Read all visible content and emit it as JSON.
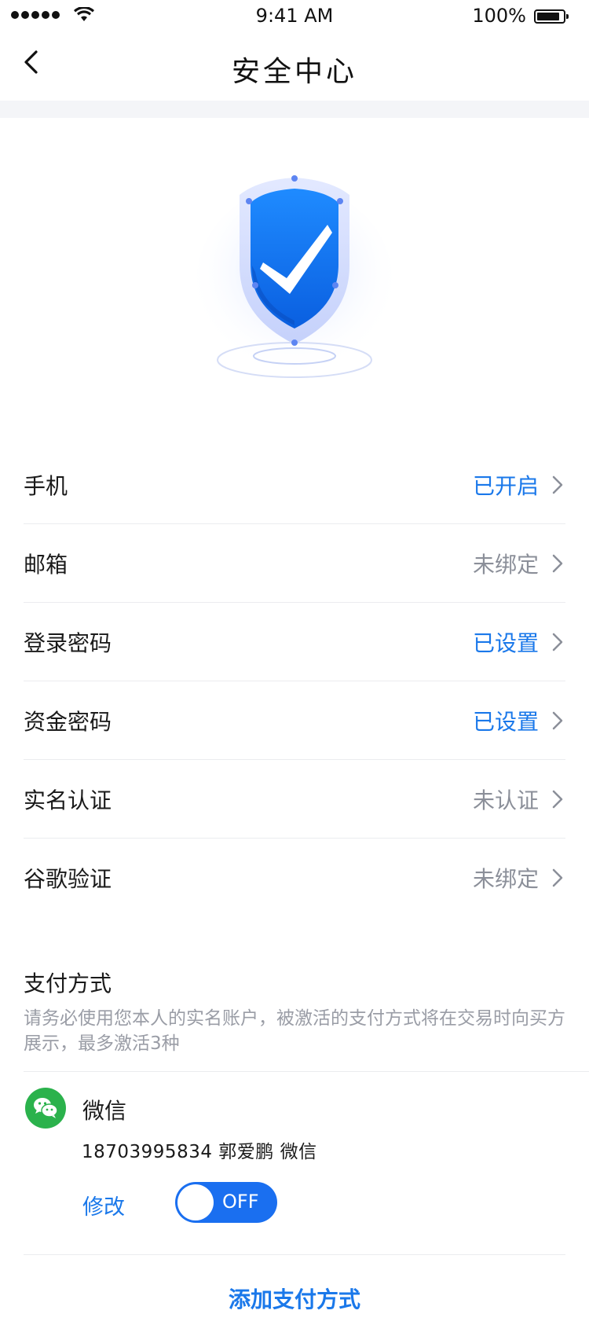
{
  "status_bar": {
    "time": "9:41 AM",
    "battery": "100%"
  },
  "nav": {
    "title": "安全中心"
  },
  "accent_color": "#1a78ea",
  "security_items": [
    {
      "label": "手机",
      "value": "已开启",
      "state": "active"
    },
    {
      "label": "邮箱",
      "value": "未绑定",
      "state": "inactive"
    },
    {
      "label": "登录密码",
      "value": "已设置",
      "state": "active"
    },
    {
      "label": "资金密码",
      "value": "已设置",
      "state": "active"
    },
    {
      "label": "实名认证",
      "value": "未认证",
      "state": "inactive"
    },
    {
      "label": "谷歌验证",
      "value": "未绑定",
      "state": "inactive"
    }
  ],
  "payment": {
    "title": "支付方式",
    "description": "请务必使用您本人的实名账户，被激活的支付方式将在交易时向买方展示，最多激活3种",
    "method": {
      "name": "微信",
      "info": "18703995834  郭爱鹏  微信",
      "edit_label": "修改",
      "toggle_label": "OFF",
      "icon": "wechat-icon"
    },
    "add_label": "添加支付方式"
  }
}
